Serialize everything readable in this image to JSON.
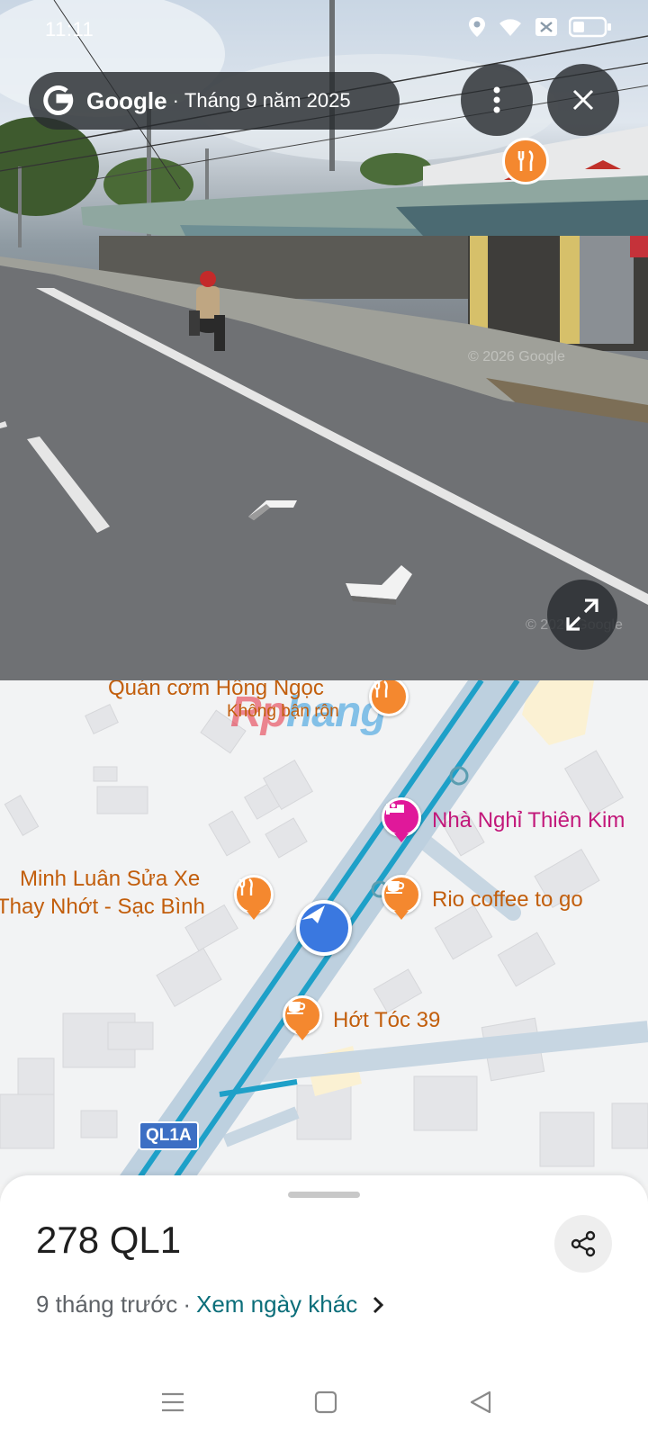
{
  "status_bar": {
    "time": "11:11",
    "icons": [
      "location-icon",
      "wifi-icon",
      "sim-disabled-icon",
      "battery-icon"
    ]
  },
  "street_view": {
    "brand": "Google",
    "separator": "·",
    "capture_date": "Tháng 9 năm 2025",
    "more_button_icon": "more-vert-icon",
    "close_button_icon": "close-icon",
    "expand_button_icon": "expand-icon",
    "poi_icon": "restaurant-icon",
    "watermark": "© 2026 Google"
  },
  "map": {
    "watermark_logo_part1": "Rp",
    "watermark_logo_part2": "hang",
    "pois": [
      {
        "label_line1": "Quán cơm Hồng Ngọc",
        "label_line2": "Không bận rộn",
        "icon": "restaurant-icon",
        "color": "#f4882f"
      },
      {
        "label_line1": "Nhà Nghỉ Thiên Kim",
        "icon": "hotel-icon",
        "color": "#e0189a"
      },
      {
        "label_line1": "Minh Luân Sửa Xe",
        "label_line2": "Thay Nhớt - Sạc Bình",
        "icon": "restaurant-icon",
        "color": "#f4882f"
      },
      {
        "label_line1": "Rio coffee to go",
        "icon": "coffee-icon",
        "color": "#f4882f"
      },
      {
        "label_line1": "Hớt Tóc 39",
        "icon": "coffee-icon",
        "color": "#f4882f"
      }
    ],
    "road_shield": "QL1A",
    "road_color": "#1ea0c8"
  },
  "sheet": {
    "title": "278 QL1",
    "time_ago": "9 tháng trước",
    "separator": "·",
    "other_dates_link": "Xem ngày khác",
    "share_icon": "share-icon",
    "chevron_icon": "chevron-right-icon"
  },
  "system_nav": {
    "buttons": [
      "menu-icon",
      "home-icon",
      "back-icon"
    ]
  }
}
